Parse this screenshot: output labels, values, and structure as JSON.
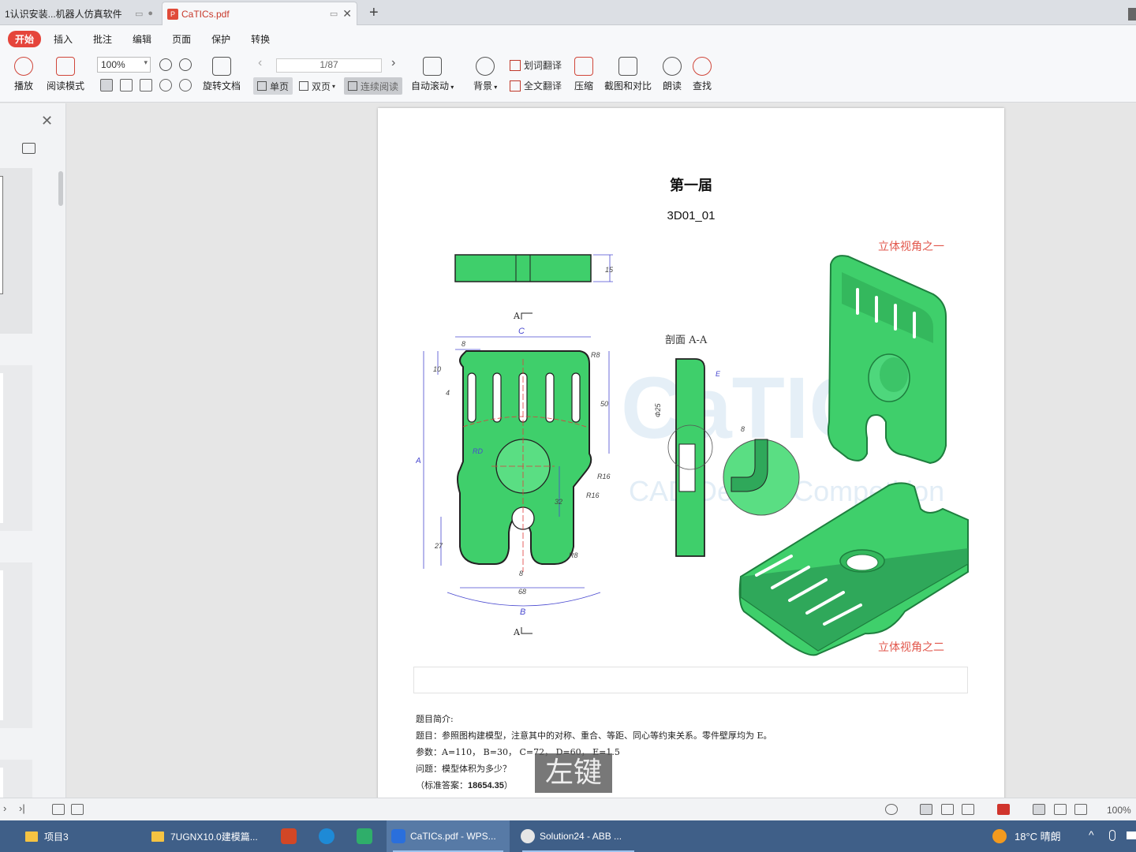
{
  "tabs": [
    {
      "label": "1认识安装...机器人仿真软件",
      "active": false
    },
    {
      "label": "CaTICs.pdf",
      "active": true
    }
  ],
  "menu": [
    "开始",
    "插入",
    "批注",
    "编辑",
    "页面",
    "保护",
    "转换"
  ],
  "toolbar": {
    "play": "播放",
    "read_mode": "阅读模式",
    "zoom": "100%",
    "rotate": "旋转文档",
    "page_indicator": "1/87",
    "single_page": "单页",
    "double_page": "双页",
    "continuous": "连续阅读",
    "auto_scroll": "自动滚动",
    "background": "背景",
    "word_translate": "划词翻译",
    "full_translate": "全文翻译",
    "compress": "压缩",
    "screenshot_compare": "截图和对比",
    "read_aloud": "朗读",
    "find": "查找"
  },
  "document": {
    "title": "第一届",
    "code": "3D01_01",
    "section_label": "剖面 A-A",
    "view_label_1": "立体视角之一",
    "view_label_2": "立体视角之二",
    "watermark": "CaTIC",
    "watermark_sub": "CAD Design Competition",
    "section_marker": "A",
    "dims": {
      "c": "C",
      "b": "B",
      "a": "A",
      "e": "E",
      "d8": "8",
      "d4": "4",
      "d10": "10",
      "d50": "50",
      "d15": "15",
      "dr8": "R8",
      "drd": "RD",
      "dr16": "R16",
      "dr16b": "R16",
      "d32": "32",
      "d27": "27",
      "d68": "68",
      "d8b": "8",
      "dr8b": "R8",
      "dphi25": "Φ25",
      "d8c": "8"
    },
    "intro_heading": "题目简介:",
    "intro_line1": "题目：参照图构建模型，注意其中的对称、重合、等距、同心等约束关系。零件壁厚均为 E。",
    "intro_line2": "参数：A=110，  B=30，  C=72，  D=60，  E=1.5",
    "intro_line3": "问题：模型体积为多少？",
    "answer_prefix": "（标准答案：",
    "answer_value": "18654.35",
    "answer_suffix": "）"
  },
  "overlay": "左键",
  "status": {
    "zoom": "100%"
  },
  "taskbar": {
    "items": [
      "项目3",
      "7UGNX10.0建模篇...",
      "CaTICs.pdf - WPS...",
      "Solution24 - ABB ..."
    ],
    "weather": "18°C  晴朗"
  },
  "colors": {
    "accent": "#e5453b",
    "part_green": "#3fcf6b",
    "dim_blue": "#4a4ad0",
    "label_red": "#e2574c",
    "taskbar": "#3f5f88"
  }
}
